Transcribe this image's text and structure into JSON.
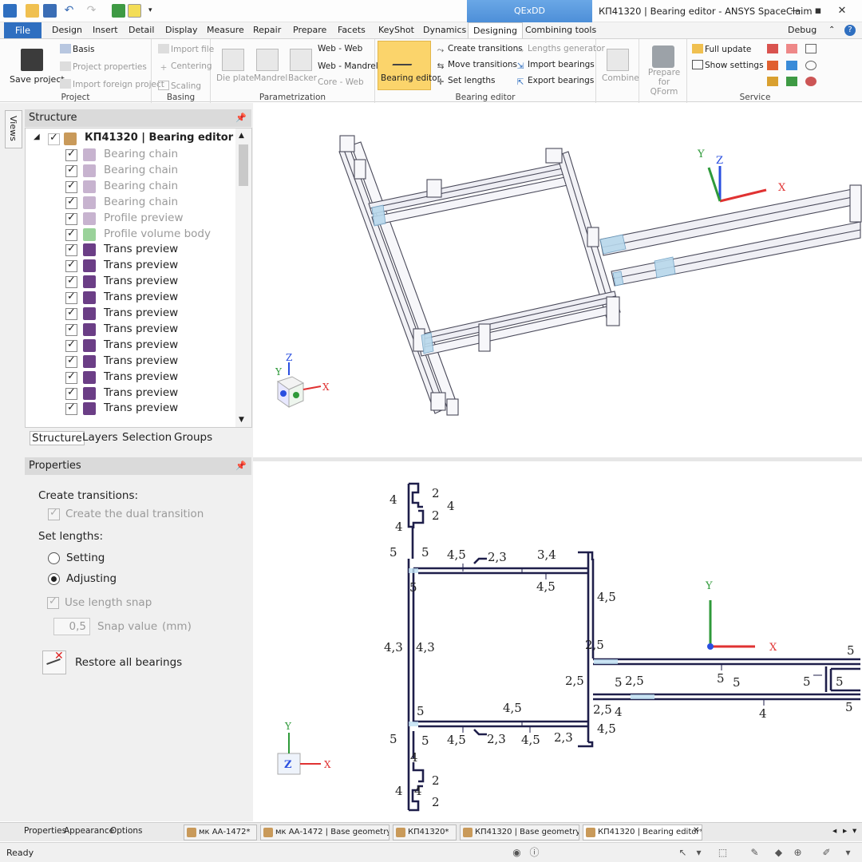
{
  "window": {
    "qexdd_tab": "QExDD",
    "title": "КП41320 | Bearing editor - ANSYS SpaceClaim"
  },
  "tabs": {
    "file": "File",
    "items": [
      "Design",
      "Insert",
      "Detail",
      "Display",
      "Measure",
      "Repair",
      "Prepare",
      "Facets",
      "KeyShot",
      "Dynamics",
      "Designing",
      "Combining tools"
    ],
    "active": "Designing",
    "debug": "Debug"
  },
  "ribbon": {
    "project": {
      "label": "Project",
      "save": "Save project",
      "basis": "Basis",
      "project_properties": "Project properties",
      "import_foreign": "Import foreign project"
    },
    "basing": {
      "label": "Basing",
      "import_file": "Import file",
      "centering": "Centering",
      "scaling": "Scaling"
    },
    "parametrization": {
      "label": "Parametrization",
      "die_plate": "Die plate",
      "mandrel": "Mandrel",
      "backer": "Backer",
      "web_web": "Web - Web",
      "web_mandrel": "Web - Mandrel",
      "core_web": "Core - Web"
    },
    "bearing_editor": {
      "label": "Bearing editor",
      "bearing_editor_btn": "Bearing editor",
      "create_transitions": "Create transitions",
      "move_transitions": "Move transitions",
      "set_lengths": "Set lengths",
      "lengths_generator": "Lengths generator",
      "import_bearings": "Import bearings",
      "export_bearings": "Export bearings"
    },
    "combine": "Combine",
    "prepare_qform": "Prepare for QForm",
    "service": {
      "label": "Service",
      "full_update": "Full update",
      "show_settings": "Show settings"
    }
  },
  "views_tab": "Views",
  "structure": {
    "header": "Structure",
    "root": "КП41320 | Bearing editor",
    "items": [
      "Bearing chain",
      "Bearing chain",
      "Bearing chain",
      "Bearing chain",
      "Profile preview",
      "Profile volume body",
      "Trans preview",
      "Trans preview",
      "Trans preview",
      "Trans preview",
      "Trans preview",
      "Trans preview",
      "Trans preview",
      "Trans preview",
      "Trans preview",
      "Trans preview",
      "Trans preview"
    ],
    "tabs": [
      "Structure",
      "Layers",
      "Selection",
      "Groups"
    ]
  },
  "properties": {
    "header": "Properties",
    "create_transitions": "Create transitions:",
    "dual_transition": "Create the dual transition",
    "set_lengths": "Set lengths:",
    "setting": "Setting",
    "adjusting": "Adjusting",
    "use_length_snap": "Use length snap",
    "snap_value": "0,5",
    "snap_label": "Snap value",
    "snap_unit": "(mm)",
    "restore": "Restore all bearings",
    "bottom_tabs": [
      "Properties",
      "Appearance",
      "Options"
    ]
  },
  "doc_tabs": [
    "мк АА-1472*",
    "мк АА-1472 | Base geometry*",
    "КП41320*",
    "КП41320 | Base geometry*",
    "КП41320 | Bearing editor*"
  ],
  "status": "Ready",
  "axes": {
    "x": "X",
    "y": "Y",
    "z": "Z"
  },
  "colors": {
    "accent": "#2f6fc0",
    "highlight": "#fbd46b",
    "profile": "#1e1e4a"
  }
}
